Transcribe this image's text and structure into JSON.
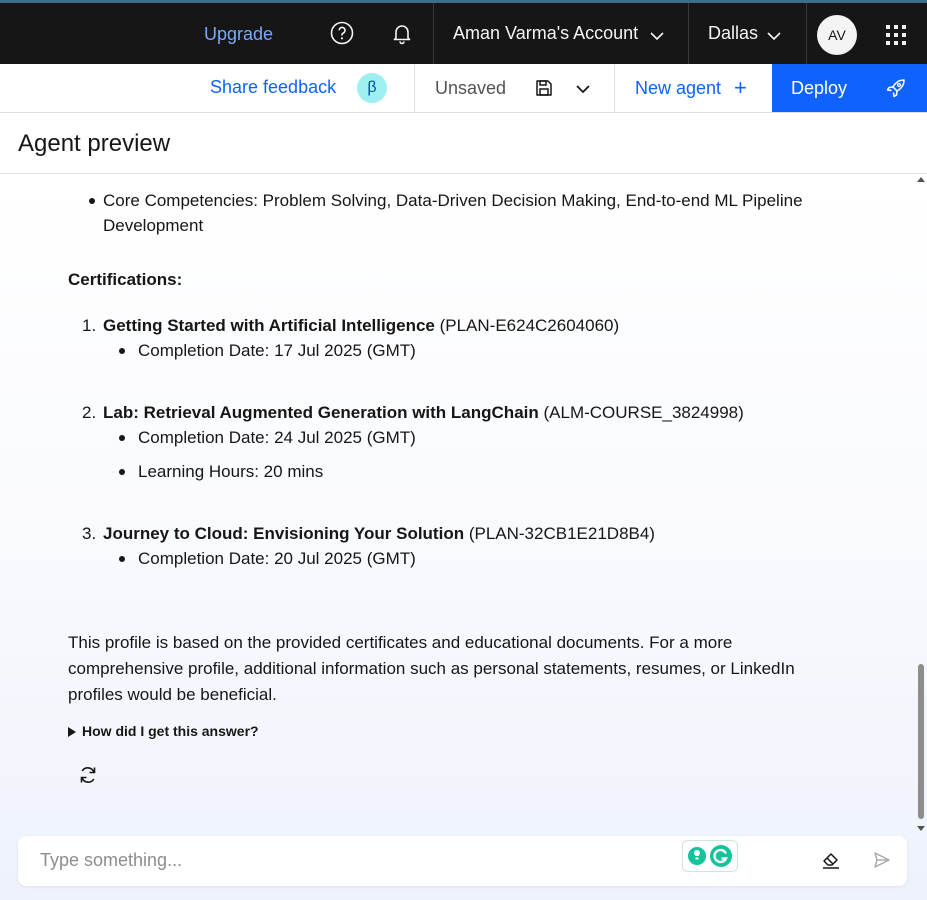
{
  "topnav": {
    "upgrade": "Upgrade",
    "account": "Aman Varma's Account",
    "region": "Dallas",
    "avatar_initials": "AV",
    "icons": [
      "help-icon",
      "notification-icon",
      "chevron-down-icon",
      "app-switcher-icon"
    ]
  },
  "toolbar": {
    "share_feedback": "Share feedback",
    "beta_badge": "β",
    "status": "Unsaved",
    "new_agent": "New agent",
    "new_agent_plus": "+",
    "deploy": "Deploy"
  },
  "preview": {
    "title": "Agent preview"
  },
  "message": {
    "competencies_line1": "Core Competencies: Problem Solving, Data-Driven Decision Making, End-to-end ML Pipeline",
    "competencies_line2": "Development",
    "certifications_heading": "Certifications:",
    "certifications": [
      {
        "number": "1.",
        "title": "Getting Started with Artificial Intelligence",
        "code": "(PLAN-E624C2604060)",
        "details": [
          "Completion Date: 17 Jul 2025 (GMT)"
        ]
      },
      {
        "number": "2.",
        "title": "Lab: Retrieval Augmented Generation with LangChain",
        "code": "(ALM-COURSE_3824998)",
        "details": [
          "Completion Date: 24 Jul 2025 (GMT)",
          "Learning Hours: 20 mins"
        ]
      },
      {
        "number": "3.",
        "title": "Journey to Cloud: Envisioning Your Solution",
        "code": "(PLAN-32CB1E21D8B4)",
        "details": [
          "Completion Date: 20 Jul 2025 (GMT)"
        ]
      }
    ],
    "summary_line1": "This profile is based on the provided certificates and educational documents. For a more",
    "summary_line2": "comprehensive profile, additional information such as personal statements, resumes, or LinkedIn",
    "summary_line3": "profiles would be beneficial.",
    "explain_toggle": "How did I get this answer?"
  },
  "input": {
    "placeholder": "Type something..."
  },
  "colors": {
    "accent": "#0f62fe",
    "nav_bg": "#161616",
    "beta_bg": "#9ef0f0"
  }
}
